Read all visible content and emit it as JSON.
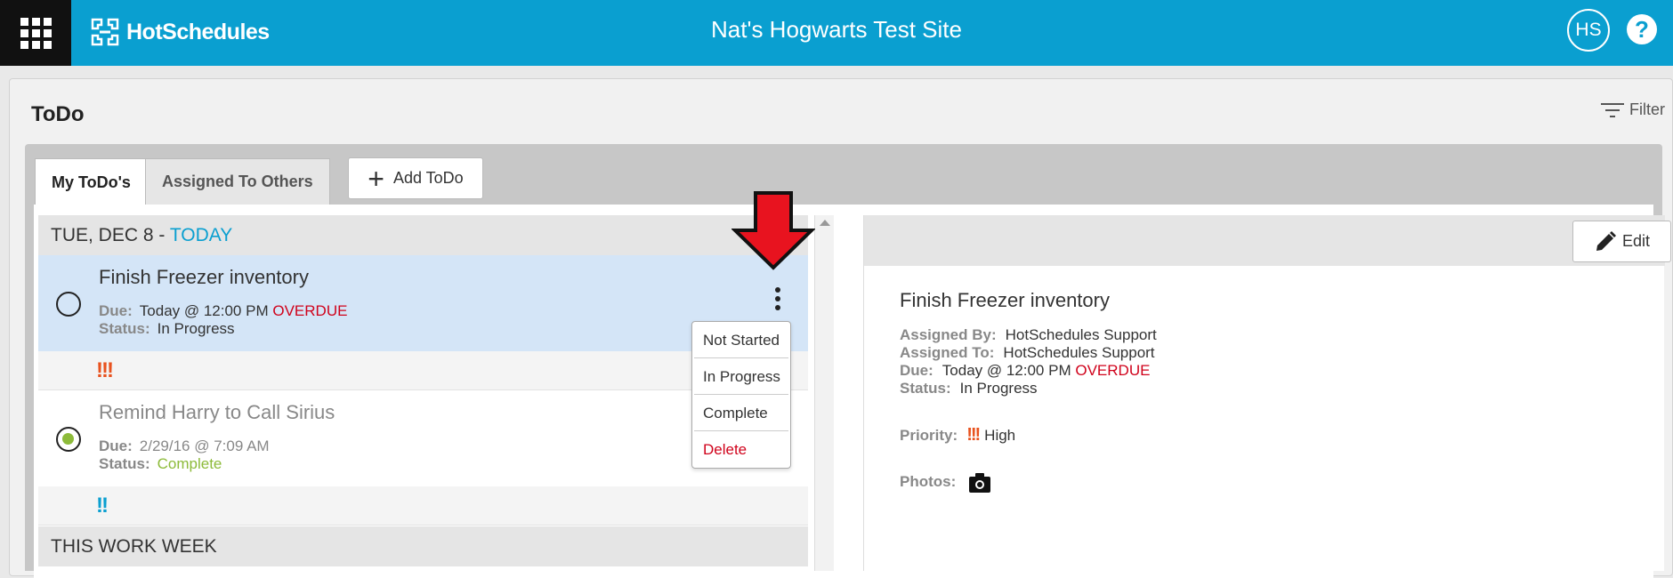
{
  "header": {
    "brand": "HotSchedules",
    "site_title": "Nat's Hogwarts Test Site",
    "avatar_initials": "HS",
    "help_label": "?"
  },
  "page": {
    "title": "ToDo",
    "filter_label": "Filter"
  },
  "tabs": [
    {
      "label": "My ToDo's",
      "active": true
    },
    {
      "label": "Assigned To Others",
      "active": false
    }
  ],
  "add_button_label": "Add ToDo",
  "list": {
    "day_header_date": "TUE, DEC 8 - ",
    "day_header_today": "TODAY",
    "section2_header": "THIS WORK WEEK",
    "tasks": [
      {
        "title": "Finish Freezer inventory",
        "due_label": "Due:",
        "due_value": "Today @ 12:00 PM",
        "overdue": "OVERDUE",
        "status_label": "Status:",
        "status_value": "In Progress",
        "priority_marks": "!!!",
        "priority": "high"
      },
      {
        "title": "Remind Harry to Call Sirius",
        "due_label": "Due:",
        "due_value": "2/29/16 @ 7:09 AM",
        "status_label": "Status:",
        "status_value": "Complete",
        "priority_marks": "!!",
        "priority": "medium"
      }
    ]
  },
  "status_menu": {
    "items": [
      "Not Started",
      "In Progress",
      "Complete",
      "Delete"
    ]
  },
  "detail": {
    "edit_label": "Edit",
    "title": "Finish Freezer inventory",
    "assigned_by_label": "Assigned By:",
    "assigned_by": "HotSchedules Support",
    "assigned_to_label": "Assigned To:",
    "assigned_to": "HotSchedules Support",
    "due_label": "Due:",
    "due_value": "Today @ 12:00 PM",
    "overdue": "OVERDUE",
    "status_label": "Status:",
    "status_value": "In Progress",
    "priority_label": "Priority:",
    "priority_marks": "!!!",
    "priority_value": "High",
    "photos_label": "Photos:"
  },
  "colors": {
    "brand_blue": "#0a9fd0",
    "overdue_red": "#d0021b",
    "complete_green": "#8dbb3a",
    "priority_high": "#e8521e",
    "annotation_arrow": "#e8131f"
  },
  "icons": [
    "apps-grid-icon",
    "hotschedules-logo",
    "help-icon",
    "filter-icon",
    "plus-icon",
    "kebab-menu-icon",
    "pencil-icon",
    "camera-icon",
    "scroll-up-icon",
    "red-arrow-annotation"
  ]
}
